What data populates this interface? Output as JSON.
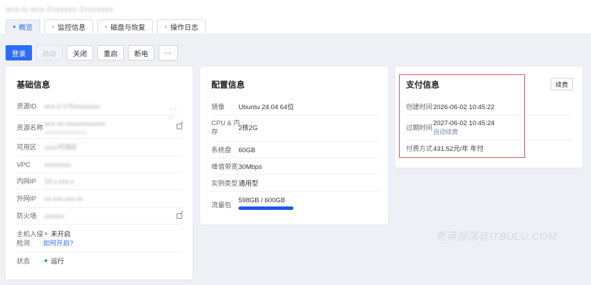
{
  "header": {
    "title": "ecs-lc-ecs-2xxxxxx-2xxxxxxx"
  },
  "tabs": [
    {
      "label": "概览",
      "active": true
    },
    {
      "label": "监控信息"
    },
    {
      "label": "磁盘与恢复"
    },
    {
      "label": "操作日志"
    }
  ],
  "actions": {
    "login": "登录",
    "start": "启动",
    "close": "关闭",
    "restart": "重启",
    "power_off": "断电",
    "more": "···"
  },
  "basic": {
    "title": "基础信息",
    "resource_id": {
      "label": "资源ID",
      "value": "ecs-2-175xxxxxxxx",
      "extra": "云主机"
    },
    "resource_name": {
      "label": "资源名称",
      "value": "ecs-xx-xxxxxxxxxxxx",
      "sub": "xxxxxxxxxxxxxxx"
    },
    "zone": {
      "label": "可用区",
      "value": "xxxx可用区"
    },
    "vpc": {
      "label": "VPC",
      "value": "xxxxxxxx"
    },
    "private_ip": {
      "label": "内网IP",
      "value": "10.x.xxx.x"
    },
    "public_ip": {
      "label": "外网IP",
      "value": "xx.xxx.xxx.xx"
    },
    "firewall": {
      "label": "防火墙",
      "value": "xxxxxx"
    },
    "intrusion": {
      "label_line1": "主机入侵",
      "label_line2": "检测",
      "status": "未开启",
      "link": "如何开启?",
      "dot_color": "#b0b4bb"
    },
    "state": {
      "label": "状态",
      "value": "运行",
      "dot_color": "#27b148"
    }
  },
  "config": {
    "title": "配置信息",
    "image": {
      "label": "镜像",
      "value": "Ubuntu 24.04 64位"
    },
    "cpu_mem": {
      "label_line1": "CPU & 内",
      "label_line2": "存",
      "value": "2核2G"
    },
    "system_disk": {
      "label": "系统盘",
      "value": "60GB"
    },
    "bandwidth": {
      "label": "峰值带宽",
      "value": "30Mbps"
    },
    "instance_type": {
      "label": "实例类型",
      "value": "通用型"
    },
    "traffic": {
      "label": "流量包",
      "value": "598GB / 600GB",
      "used_fraction": 0.997,
      "bar_color": "#1e57e6"
    }
  },
  "payment": {
    "title": "支付信息",
    "renew_label": "续费",
    "created": {
      "label": "创建时间",
      "value": "2026-06-02 10:45:22"
    },
    "expires": {
      "label": "过期时间",
      "value": "2027-06-02 10:45:24",
      "sub": "自动续费"
    },
    "billing": {
      "label": "付费方式",
      "value": "431.52元/年 年付"
    },
    "highlight_color": "#e0505a"
  },
  "watermark": "老蒋部落@ITBULU.COM"
}
